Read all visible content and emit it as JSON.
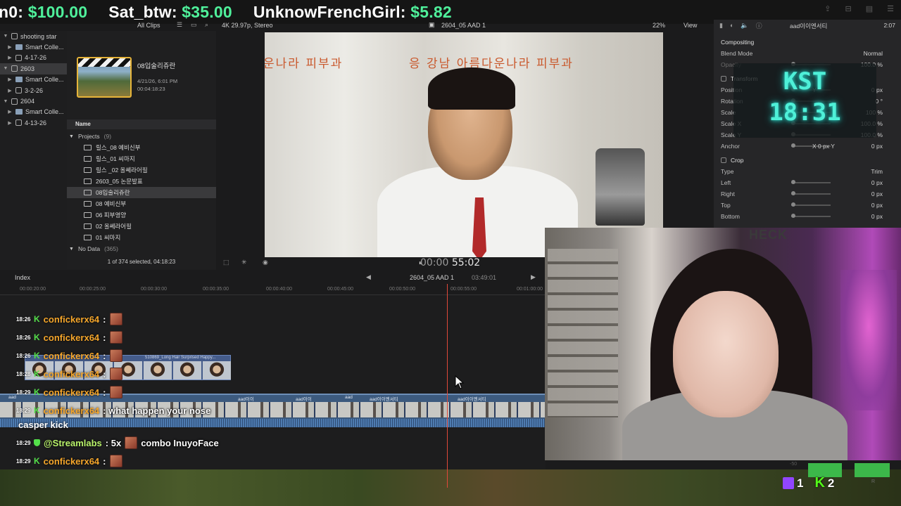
{
  "donations": [
    {
      "name": "n0:",
      "amount": "$100.00"
    },
    {
      "name": "Sat_btw:",
      "amount": "$35.00"
    },
    {
      "name": "UnknowFrenchGirl:",
      "amount": "$5.82"
    }
  ],
  "libraries": [
    {
      "label": "shooting star",
      "level": 0,
      "type": "library"
    },
    {
      "label": "Smart Colle...",
      "level": 1,
      "type": "folder"
    },
    {
      "label": "4-17-26",
      "level": 1,
      "type": "event"
    },
    {
      "label": "2603",
      "level": 0,
      "type": "library",
      "selected": true
    },
    {
      "label": "Smart Colle...",
      "level": 1,
      "type": "folder"
    },
    {
      "label": "3-2-26",
      "level": 1,
      "type": "event"
    },
    {
      "label": "2604",
      "level": 0,
      "type": "library"
    },
    {
      "label": "Smart Colle...",
      "level": 1,
      "type": "folder"
    },
    {
      "label": "4-13-26",
      "level": 1,
      "type": "event"
    }
  ],
  "browser": {
    "filter": "All Clips",
    "clip_title": "08입술리쥬란",
    "clip_date": "4/21/26, 6:01 PM",
    "clip_duration": "00:04:18:23",
    "column_header": "Name",
    "groups": [
      {
        "label": "Projects",
        "count": "(9)"
      },
      {
        "label": "No Data",
        "count": "(365)"
      }
    ],
    "items": [
      {
        "label": "릴스_08 예비신부",
        "selected": false
      },
      {
        "label": "릴스_01 씨마지",
        "selected": false
      },
      {
        "label": "릴스 _02 올쎄라어필",
        "selected": false
      },
      {
        "label": "2603_05 논문발표",
        "selected": false
      },
      {
        "label": "08입술리쥬란",
        "selected": true
      },
      {
        "label": "08 예비신부",
        "selected": false
      },
      {
        "label": "06 피부영양",
        "selected": false
      },
      {
        "label": "02 올쎄라어필",
        "selected": false
      },
      {
        "label": "01 씨마지",
        "selected": false
      }
    ],
    "footer": "1 of 374 selected, 04:18:23"
  },
  "viewer": {
    "format": "4K 29.97p, Stereo",
    "project": "2604_05 AAD 1",
    "zoom": "22%",
    "view_label": "View",
    "wall_text_left": "운나라 피부과",
    "wall_text_right": "응 강남 아름다운나라 피부과",
    "timecode_dim": "00:00",
    "timecode": "55:02"
  },
  "inspector": {
    "title": "aad이이엔서티",
    "duration": "2:07",
    "rows": [
      {
        "k": "Compositing",
        "v": "",
        "hdr": true
      },
      {
        "k": "Blend Mode",
        "v": "Normal"
      },
      {
        "k": "Opacity",
        "v": "100.0 %",
        "dim": true
      },
      {
        "k": "Transform",
        "v": "",
        "hdr": true
      },
      {
        "k": "Position",
        "v": "0 px",
        "v2": "Y"
      },
      {
        "k": "Rotation",
        "v": "0 °"
      },
      {
        "k": "Scale",
        "v": "100 %"
      },
      {
        "k": "Scale X",
        "v": "100.0 %"
      },
      {
        "k": "Scale Y",
        "v": "100.0 %"
      },
      {
        "k": "Anchor",
        "v": "0 px",
        "v2": "X        0 px     Y"
      },
      {
        "k": "Crop",
        "v": "",
        "hdr": true
      },
      {
        "k": "Type",
        "v": "Trim"
      },
      {
        "k": "Left",
        "v": "0 px"
      },
      {
        "k": "Right",
        "v": "0 px"
      },
      {
        "k": "Top",
        "v": "0 px"
      },
      {
        "k": "Bottom",
        "v": "0 px"
      }
    ]
  },
  "clock": {
    "line1": "KST",
    "line2": "18:31"
  },
  "timeline": {
    "index_label": "Index",
    "project": "2604_05 AAD 1",
    "duration": "03:49:01",
    "ruler": [
      "00:00:20:00",
      "00:00:25:00",
      "00:00:30:00",
      "00:00:35:00",
      "00:00:40:00",
      "00:00:45:00",
      "00:00:50:00",
      "00:00:55:00",
      "00:01:00:00"
    ],
    "broll_name": "510869_Long Hair Surprised Happy...",
    "track_labels": [
      "aad",
      "aad이이",
      "aad이이",
      "aad",
      "aad이이엔서티",
      "aad이이엔서티"
    ]
  },
  "chat": [
    {
      "time": "18:26",
      "user": "confickerx64",
      "text": ":",
      "emote": true
    },
    {
      "time": "18:26",
      "user": "confickerx64",
      "text": ":",
      "emote": true
    },
    {
      "time": "18:26",
      "user": "confickerx64",
      "text": ":",
      "emote": true
    },
    {
      "time": "18:28",
      "user": "confickerx64",
      "text": ":",
      "emote": true
    },
    {
      "time": "18:29",
      "user": "confickerx64",
      "text": ":",
      "emote": true
    },
    {
      "time": "18:29",
      "user": "confickerx64",
      "text": ": what happen your nose",
      "emote": false
    },
    {
      "time": "18:29",
      "user": "@Streamlabs",
      "text": ": 5x",
      "emote": true,
      "after": "combo InuyoFace",
      "mod": true
    },
    {
      "time": "18:29",
      "user": "confickerx64",
      "text": ":",
      "emote": true
    }
  ],
  "chat_wrap": "casper kick",
  "webcam_sign": "HECK",
  "meters": {
    "db_label": "-50",
    "r_label": "R"
  },
  "viewers": {
    "twitch": "1",
    "kick": "2",
    "kick_glyph": "K"
  },
  "colors": {
    "donation_amount": "#4ff09b",
    "chat_user": "#f5a62b",
    "kick_green": "#54e04a",
    "clock": "#4ef0d8",
    "playhead": "#e0493a"
  }
}
